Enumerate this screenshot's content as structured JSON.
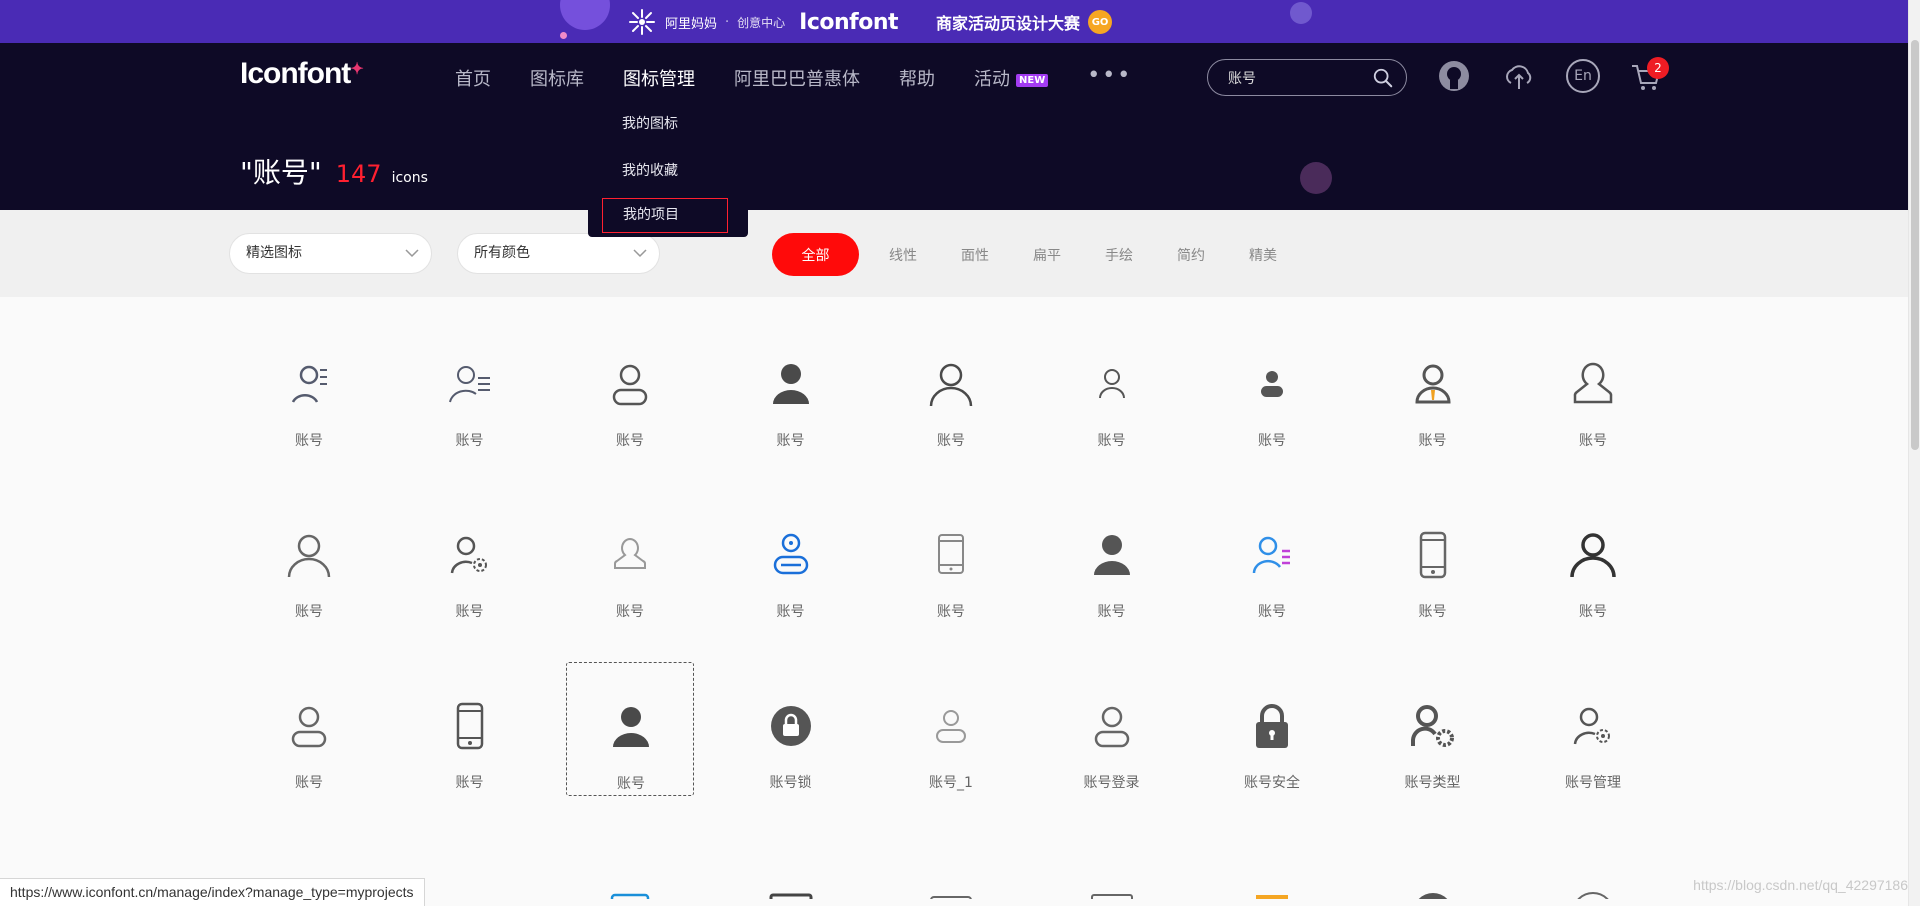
{
  "promo": {
    "brand": "阿里妈妈",
    "separator": "·",
    "subtitle": "创意中心",
    "iconfont": "Iconfont",
    "title": "商家活动页设计大赛",
    "go": "GO"
  },
  "header": {
    "logo": "Iconfont",
    "nav": [
      {
        "label": "首页"
      },
      {
        "label": "图标库"
      },
      {
        "label": "图标管理"
      },
      {
        "label": "阿里巴巴普惠体"
      },
      {
        "label": "帮助"
      },
      {
        "label": "活动",
        "badge": "NEW"
      }
    ],
    "more": "•••",
    "search": {
      "value": "账号"
    },
    "lang": "En",
    "cart_count": "2"
  },
  "dropdown": {
    "items": [
      "我的图标",
      "我的收藏",
      "我的项目"
    ]
  },
  "result": {
    "query": "\"账号\"",
    "count": "147",
    "unit": "icons"
  },
  "filters": {
    "type_select": "精选图标",
    "color_select": "所有颜色",
    "tabs": [
      "全部",
      "线性",
      "面性",
      "扁平",
      "手绘",
      "简约",
      "精美"
    ]
  },
  "icons": [
    {
      "label": "账号",
      "icon": "user-lines-icon",
      "color": "#555b6e"
    },
    {
      "label": "账号",
      "icon": "user-list-icon",
      "color": "#555b6e"
    },
    {
      "label": "账号",
      "icon": "user-outline-icon",
      "color": "#555555"
    },
    {
      "label": "账号",
      "icon": "user-filled-icon",
      "color": "#4a4a4a"
    },
    {
      "label": "账号",
      "icon": "user-thin-icon",
      "color": "#4a4a4a"
    },
    {
      "label": "账号",
      "icon": "user-small-icon",
      "color": "#555555"
    },
    {
      "label": "账号",
      "icon": "user-small-filled-icon",
      "color": "#555555"
    },
    {
      "label": "账号",
      "icon": "user-tie-icon",
      "color": "#555555"
    },
    {
      "label": "账号",
      "icon": "user-bust-icon",
      "color": "#555555"
    },
    {
      "label": "账号",
      "icon": "user-thin-icon",
      "color": "#666666"
    },
    {
      "label": "账号",
      "icon": "user-gear-icon",
      "color": "#555555"
    },
    {
      "label": "账号",
      "icon": "user-bust-light-icon",
      "color": "#999999"
    },
    {
      "label": "账号",
      "icon": "user-blue-icon",
      "color": "#1a6fd9"
    },
    {
      "label": "账号",
      "icon": "tablet-icon",
      "color": "#888888"
    },
    {
      "label": "账号",
      "icon": "user-filled-icon",
      "color": "#555555"
    },
    {
      "label": "账号",
      "icon": "user-blue-list-icon",
      "color": "#2f8fe8"
    },
    {
      "label": "账号",
      "icon": "phone-icon",
      "color": "#666666"
    },
    {
      "label": "账号",
      "icon": "user-bold-icon",
      "color": "#333333"
    },
    {
      "label": "账号",
      "icon": "user-outline-icon",
      "color": "#666666"
    },
    {
      "label": "账号",
      "icon": "phone-icon",
      "color": "#555555"
    },
    {
      "label": "账号",
      "icon": "user-filled-icon",
      "color": "#4a4a4a"
    },
    {
      "label": "账号锁",
      "icon": "lock-circle-icon",
      "color": "#555555"
    },
    {
      "label": "账号_1",
      "icon": "user-light-icon",
      "color": "#999999"
    },
    {
      "label": "账号登录",
      "icon": "user-outline-icon",
      "color": "#666666"
    },
    {
      "label": "账号安全",
      "icon": "padlock-icon",
      "color": "#555555"
    },
    {
      "label": "账号类型",
      "icon": "user-gear-bold-icon",
      "color": "#555555"
    },
    {
      "label": "账号管理",
      "icon": "user-gear-icon",
      "color": "#555555"
    }
  ],
  "partial_icons": [
    {
      "icon": "card-blue-icon",
      "color": "#1a8fd9"
    },
    {
      "icon": "id-card-icon",
      "color": "#444444"
    },
    {
      "icon": "id-card-outline-icon",
      "color": "#666666"
    },
    {
      "icon": "form-icon",
      "color": "#666666"
    },
    {
      "icon": "warning-icon",
      "color": "#f5a623"
    },
    {
      "icon": "grid-circle-icon",
      "color": "#555555"
    },
    {
      "icon": "user-circle-icon",
      "color": "#666666"
    }
  ],
  "status_url": "https://www.iconfont.cn/manage/index?manage_type=myprojects",
  "watermark": "https://blog.csdn.net/qq_42297186"
}
